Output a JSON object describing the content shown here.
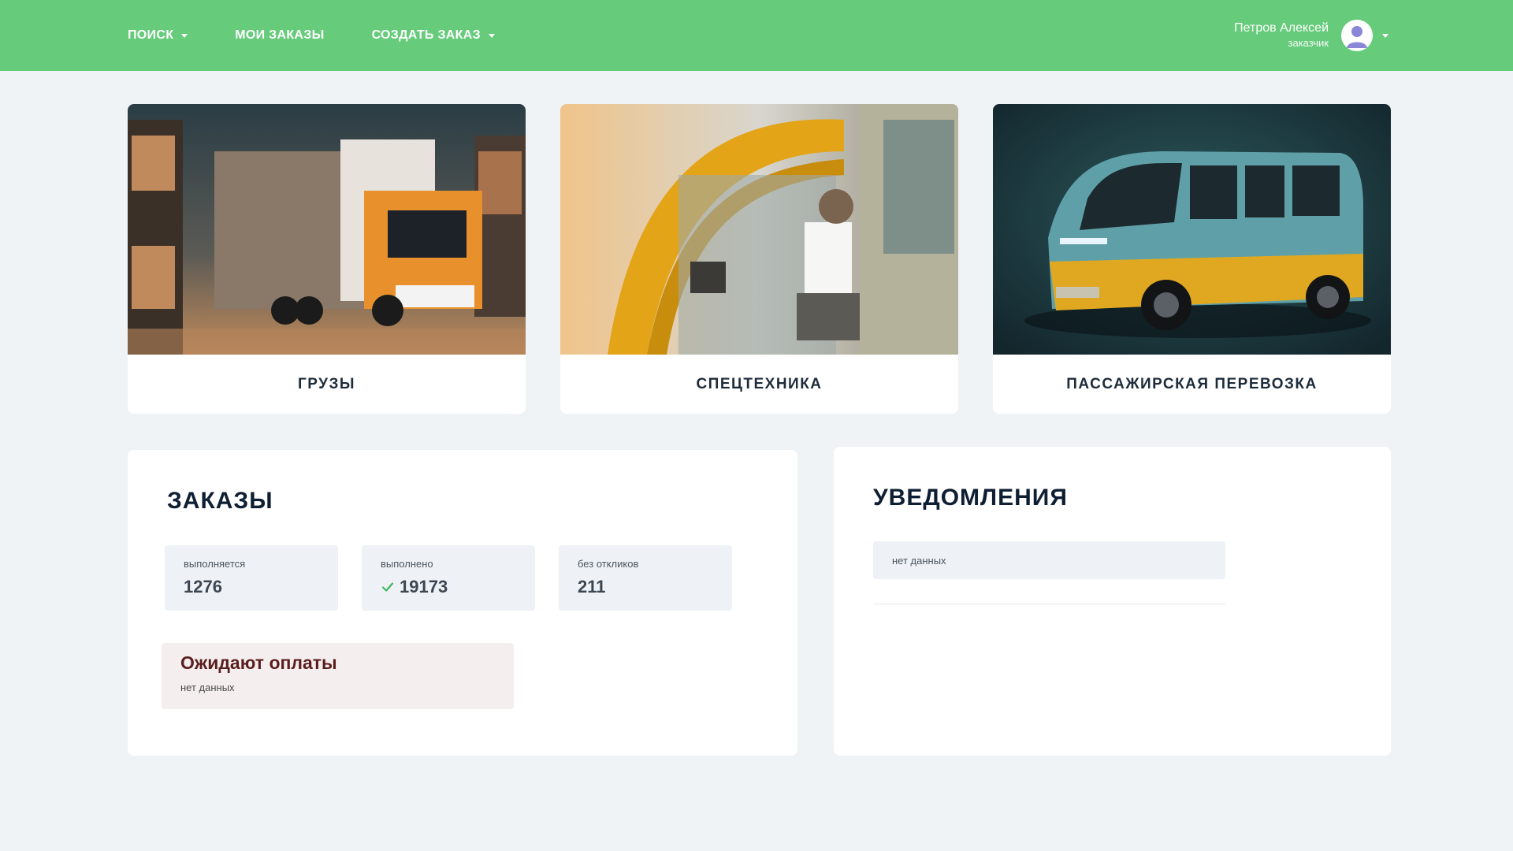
{
  "header": {
    "nav": [
      {
        "label": "ПОИСК",
        "dropdown": true
      },
      {
        "label": "МОИ ЗАКАЗЫ",
        "dropdown": false
      },
      {
        "label": "СОЗДАТЬ ЗАКАЗ",
        "dropdown": true
      }
    ],
    "user": {
      "name": "Петров Алексей",
      "role": "заказчик"
    }
  },
  "categories": [
    {
      "label": "ГРУЗЫ",
      "icon": "truck-image"
    },
    {
      "label": "СПЕЦТЕХНИКА",
      "icon": "excavator-cab-image"
    },
    {
      "label": "ПАССАЖИРСКАЯ ПЕРЕВОЗКА",
      "icon": "van-image"
    }
  ],
  "orders": {
    "title": "ЗАКАЗЫ",
    "stats": [
      {
        "label": "выполняется",
        "value": "1276",
        "check": false
      },
      {
        "label": "выполнено",
        "value": "19173",
        "check": true
      },
      {
        "label": "без откликов",
        "value": "211",
        "check": false
      }
    ],
    "awaiting": {
      "title": "Ожидают оплаты",
      "empty": "нет данных"
    }
  },
  "notifications": {
    "title": "УВЕДОМЛЕНИЯ",
    "empty": "нет данных"
  },
  "colors": {
    "header": "#66cb7b",
    "background": "#eff3f6",
    "check": "#3fb55f",
    "awaiting_bg": "#f5eeee",
    "awaiting_title": "#5a1e1e"
  }
}
